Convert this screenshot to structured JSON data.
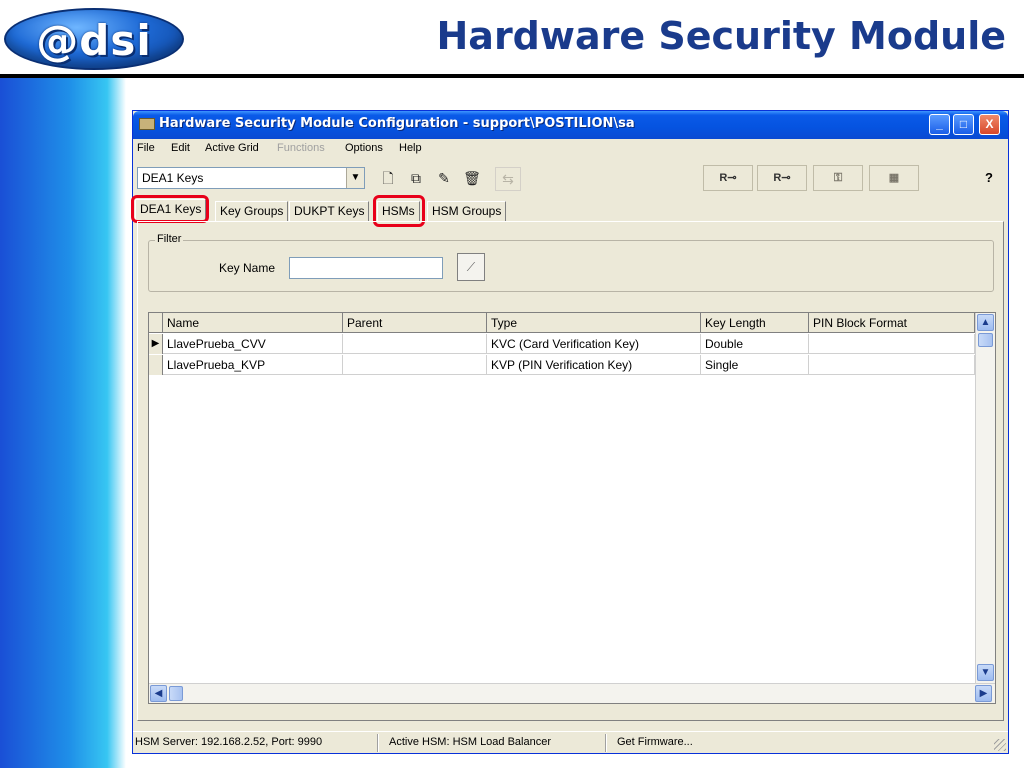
{
  "slide": {
    "logo_text": "@dsi",
    "title": "Hardware Security Module"
  },
  "window": {
    "title": "Hardware Security Module Configuration - support\\POSTILION\\sa",
    "controls": {
      "minimize": "_",
      "maximize": "□",
      "close": "X"
    }
  },
  "menu": [
    {
      "label": "File",
      "enabled": true
    },
    {
      "label": "Edit",
      "enabled": true
    },
    {
      "label": "Active Grid",
      "enabled": true
    },
    {
      "label": "Functions",
      "enabled": false
    },
    {
      "label": "Options",
      "enabled": true
    },
    {
      "label": "Help",
      "enabled": true
    }
  ],
  "toolbar": {
    "selector_value": "DEA1 Keys",
    "new_icon": "new-document-icon",
    "copy_icon": "copy-icon",
    "edit_icon": "edit-pencil-icon",
    "delete_icon": "trash-icon",
    "key_buttons": [
      "R",
      "R",
      "",
      ""
    ],
    "help_label": "?"
  },
  "tabs": [
    {
      "label": "DEA1 Keys",
      "active": true,
      "highlighted": true
    },
    {
      "label": "Key Groups",
      "active": false,
      "highlighted": false
    },
    {
      "label": "DUKPT Keys",
      "active": false,
      "highlighted": false
    },
    {
      "label": "HSMs",
      "active": false,
      "highlighted": true
    },
    {
      "label": "HSM Groups",
      "active": false,
      "highlighted": false
    }
  ],
  "filter": {
    "legend": "Filter",
    "key_name_label": "Key Name",
    "key_name_value": ""
  },
  "grid": {
    "columns": [
      "Name",
      "Parent",
      "Type",
      "Key Length",
      "PIN Block Format"
    ],
    "rows": [
      {
        "current": true,
        "cells": [
          "LlavePrueba_CVV",
          "",
          "KVC (Card Verification Key)",
          "Double",
          ""
        ]
      },
      {
        "current": false,
        "cells": [
          "LlavePrueba_KVP",
          "",
          "KVP (PIN Verification Key)",
          "Single",
          ""
        ]
      }
    ]
  },
  "status": {
    "server": "HSM Server: 192.168.2.52, Port: 9990",
    "active_hsm": "Active HSM: HSM Load Balancer",
    "firmware": "Get Firmware..."
  },
  "colors": {
    "slide_title": "#1a3b8c",
    "highlight": "#e8001a",
    "xp_titlebar": "#0553e0"
  }
}
